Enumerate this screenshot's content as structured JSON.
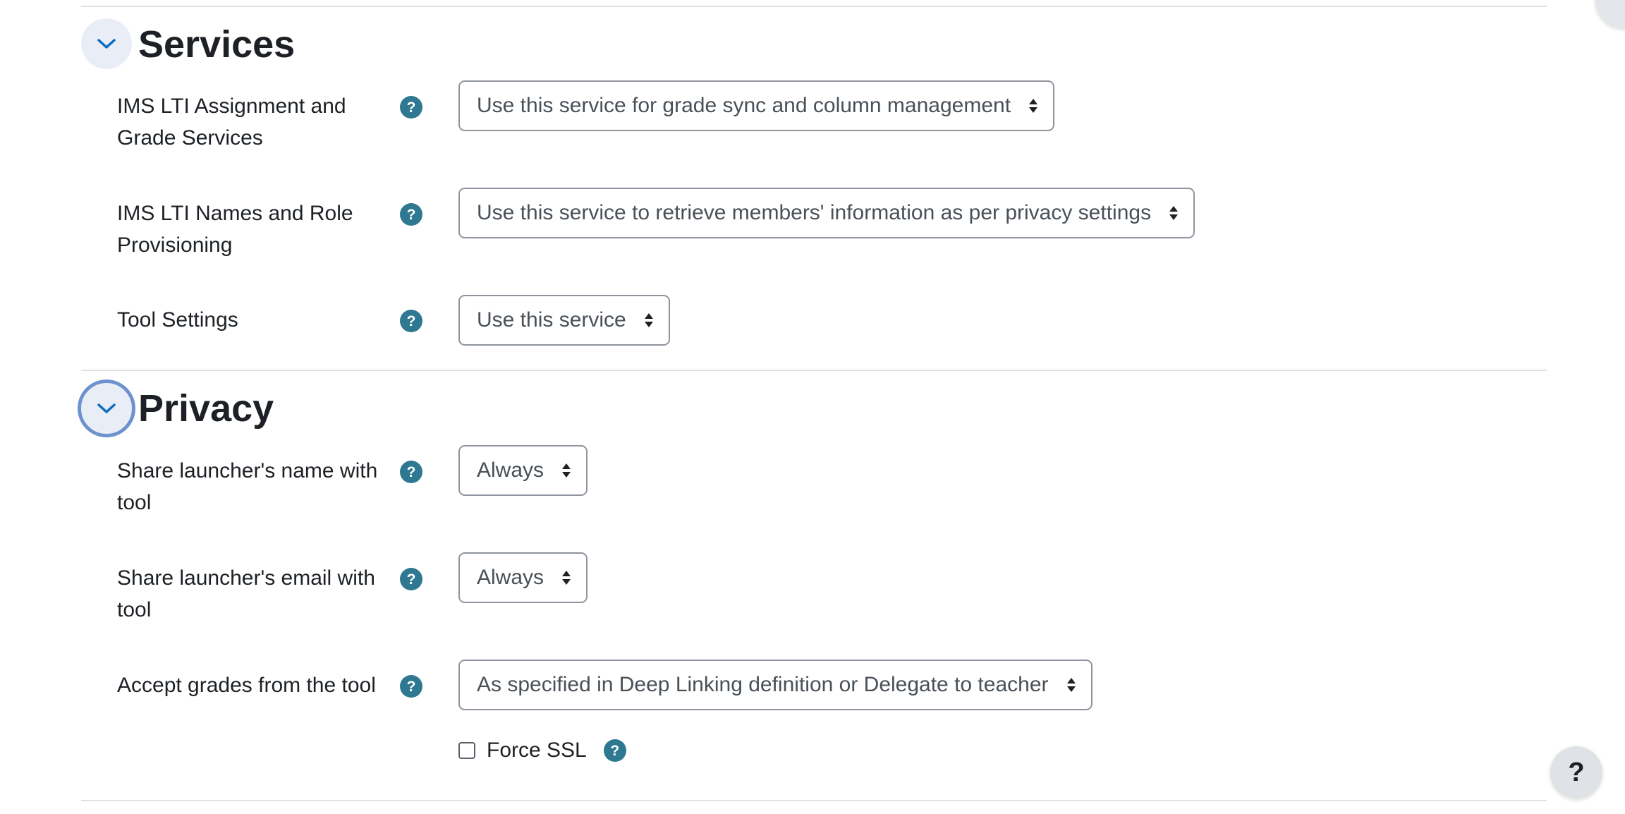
{
  "sections": {
    "services": {
      "title": "Services",
      "rows": [
        {
          "label": "IMS LTI Assignment and Grade Services",
          "value": "Use this service for grade sync and column management"
        },
        {
          "label": "IMS LTI Names and Role Provisioning",
          "value": "Use this service to retrieve members' information as per privacy settings"
        },
        {
          "label": "Tool Settings",
          "value": "Use this service"
        }
      ]
    },
    "privacy": {
      "title": "Privacy",
      "rows": [
        {
          "label": "Share launcher's name with tool",
          "value": "Always"
        },
        {
          "label": "Share launcher's email with tool",
          "value": "Always"
        },
        {
          "label": "Accept grades from the tool",
          "value": "As specified in Deep Linking definition or Delegate to teacher"
        }
      ],
      "force_ssl_label": "Force SSL",
      "force_ssl_checked": false
    }
  },
  "help_glyph": "?",
  "floating_help_glyph": "?",
  "icons": {
    "section_toggle": "chevron-down-icon",
    "help": "question-circle-icon",
    "select_arrows": "sort-arrows-icon"
  },
  "colors": {
    "help_icon": "#2f7891",
    "toggle_bg": "#e9eef6",
    "toggle_focus": "#6e92cf",
    "chevron": "#0f6cbf"
  }
}
